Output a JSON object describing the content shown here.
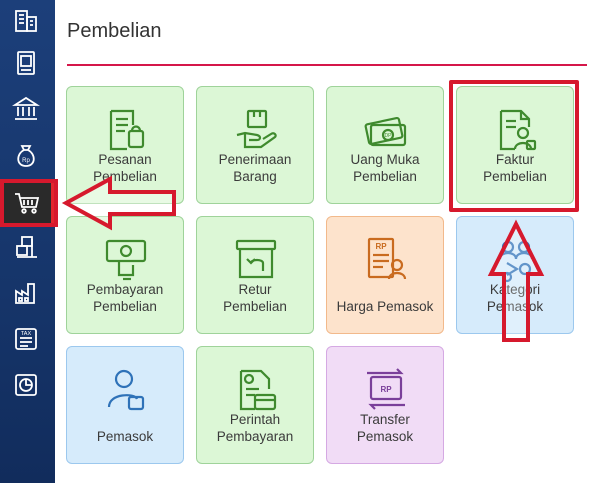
{
  "panel": {
    "title": "Pembelian"
  },
  "colors": {
    "sidebar": "#1c3f7a",
    "accent": "#d5174a",
    "highlight": "#d6192d",
    "icon_green": "#3f8a2e",
    "icon_orange": "#c96b1f",
    "icon_blue": "#2f72b8",
    "icon_purple": "#7a3f9a"
  },
  "sidebar": {
    "items": [
      {
        "icon": "building-icon"
      },
      {
        "icon": "book-icon"
      },
      {
        "icon": "bank-icon"
      },
      {
        "icon": "money-bag-icon"
      },
      {
        "icon": "cart-icon",
        "active": true
      },
      {
        "icon": "warehouse-icon"
      },
      {
        "icon": "factory-icon"
      },
      {
        "icon": "tax-icon"
      },
      {
        "icon": "report-icon"
      }
    ]
  },
  "tiles": [
    {
      "label": "Pesanan\nPembelian",
      "icon": "order-doc-icon"
    },
    {
      "label": "Penerimaan\nBarang",
      "icon": "receive-box-icon"
    },
    {
      "label": "Uang Muka\nPembelian",
      "icon": "down-payment-icon"
    },
    {
      "label": "Faktur\nPembelian",
      "icon": "invoice-icon"
    },
    {
      "label": "Pembayaran\nPembelian",
      "icon": "payment-icon"
    },
    {
      "label": "Retur\nPembelian",
      "icon": "return-box-icon"
    },
    {
      "label": "Harga Pemasok",
      "icon": "supplier-price-icon"
    },
    {
      "label": "Kategori\nPemasok",
      "icon": "supplier-category-icon"
    },
    {
      "label": "Pemasok",
      "icon": "supplier-icon"
    },
    {
      "label": "Perintah\nPembayaran",
      "icon": "payment-order-icon"
    },
    {
      "label": "Transfer\nPemasok",
      "icon": "supplier-transfer-icon"
    }
  ]
}
